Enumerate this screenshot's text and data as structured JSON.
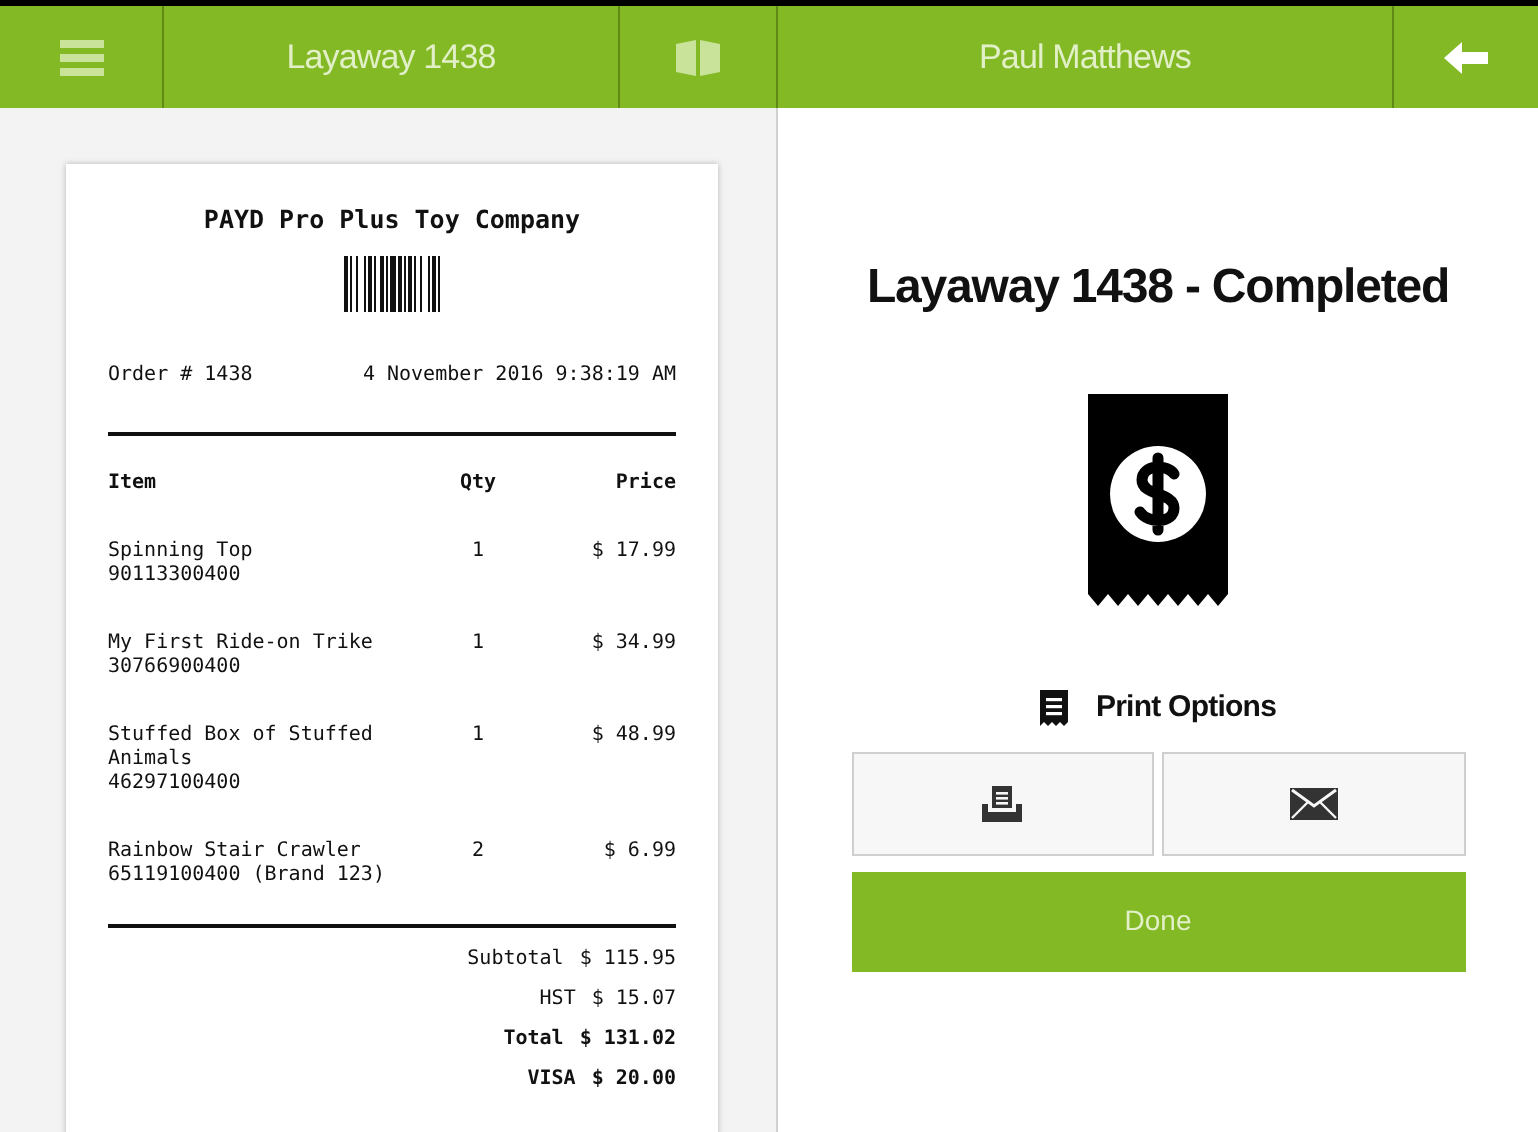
{
  "header": {
    "left_title": "Layaway 1438",
    "customer": "Paul Matthews"
  },
  "receipt": {
    "company": "PAYD Pro Plus Toy Company",
    "order": "Order # 1438",
    "date": "4 November 2016 9:38:19 AM",
    "columns": [
      "Item",
      "Qty",
      "Price"
    ],
    "items": [
      {
        "name": "Spinning Top",
        "code": "90113300400",
        "qty": "1",
        "price": "$ 17.99"
      },
      {
        "name": "My First Ride-on Trike",
        "code": "30766900400",
        "qty": "1",
        "price": "$ 34.99"
      },
      {
        "name": "Stuffed Box of Stuffed Animals",
        "code": "46297100400",
        "qty": "1",
        "price": "$ 48.99"
      },
      {
        "name": "Rainbow Stair Crawler",
        "code": "65119100400 (Brand 123)",
        "qty": "2",
        "price": "$ 6.99"
      }
    ],
    "totals": [
      {
        "label": "Subtotal",
        "value": "$ 115.95",
        "bold": false
      },
      {
        "label": "HST",
        "value": "$ 15.07",
        "bold": false
      },
      {
        "label": "Total",
        "value": "$ 131.02",
        "bold": true
      },
      {
        "label": "VISA",
        "value": "$ 20.00",
        "bold": true
      }
    ]
  },
  "status": {
    "title": "Layaway 1438 - Completed",
    "print_options": "Print Options",
    "done": "Done"
  }
}
